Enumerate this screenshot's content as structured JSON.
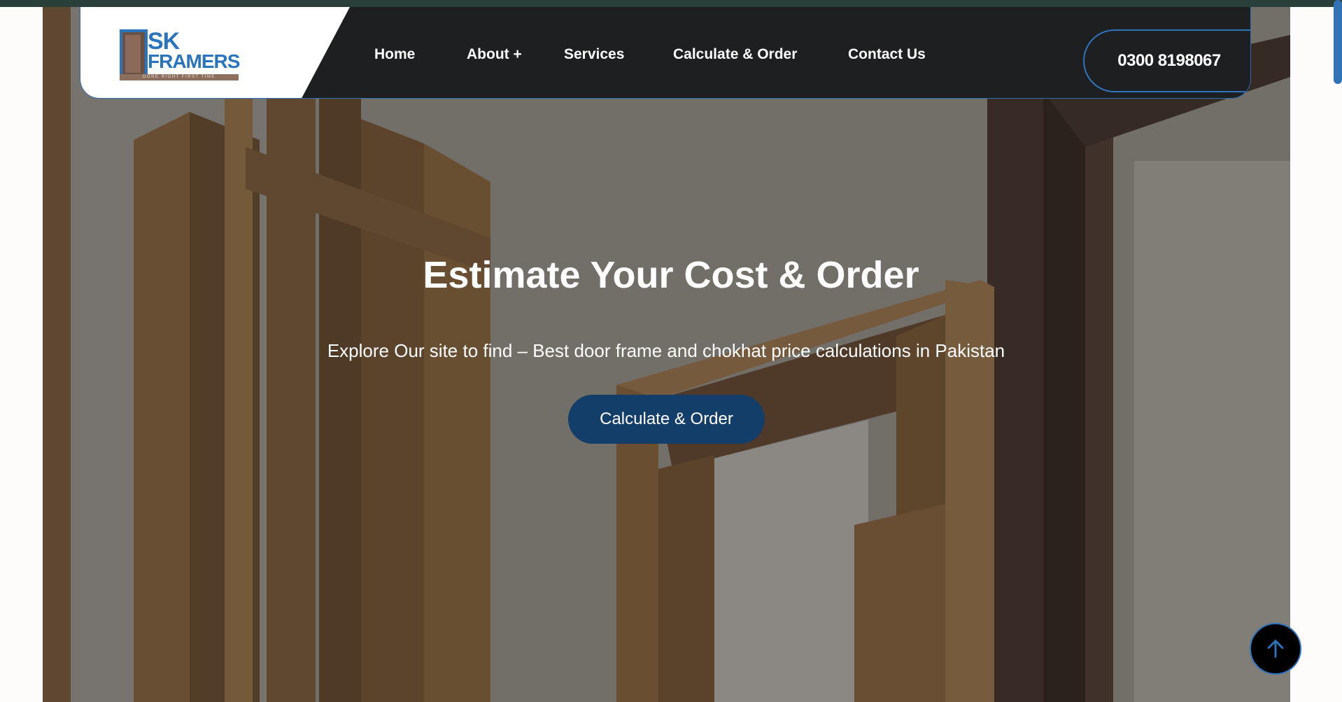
{
  "brand": {
    "logo_line1": "SK",
    "logo_line2": "FRAMERS",
    "logo_tagline": "DONE RIGHT FIRST TIME"
  },
  "nav": {
    "items": [
      {
        "label": "Home"
      },
      {
        "label": "About +"
      },
      {
        "label": "Services"
      },
      {
        "label": "Calculate & Order"
      },
      {
        "label": "Contact Us"
      }
    ]
  },
  "contact": {
    "phone": "0300 8198067",
    "icon": "phone-icon"
  },
  "hero": {
    "title": "Estimate Your Cost & Order",
    "subtitle": "Explore Our site to find – Best door frame and chokhat price calculations in Pakistan",
    "cta_label": "Calculate & Order"
  },
  "back_to_top": {
    "icon": "arrow-up-icon"
  },
  "colors": {
    "accent_blue": "#2e73ba",
    "cta_navy": "#143e6a",
    "header_dark": "#1e1f20"
  }
}
